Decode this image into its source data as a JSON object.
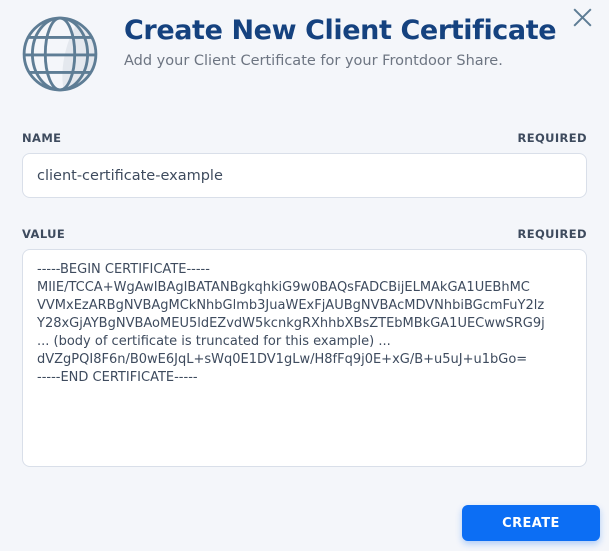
{
  "dialog": {
    "title": "Create New Client Certificate",
    "subtitle": "Add your Client Certificate for your Frontdoor Share."
  },
  "fields": {
    "name": {
      "label": "NAME",
      "required": "REQUIRED",
      "value": "client-certificate-example"
    },
    "value": {
      "label": "VALUE",
      "required": "REQUIRED",
      "value": "-----BEGIN CERTIFICATE-----\nMIIE/TCCA+WgAwIBAgIBATANBgkqhkiG9w0BAQsFADCBijELMAkGA1UEBhMC\nVVMxEzARBgNVBAgMCkNhbGlmb3JuaWExFjAUBgNVBAcMDVNhbiBGcmFuY2lz\nY28xGjAYBgNVBAoMEU5ldEZvdW5kcnkgRXhhbXBsZTEbMBkGA1UECwwSRG9j\n... (body of certificate is truncated for this example) ...\ndVZgPQI8F6n/B0wE6JqL+sWq0E1DV1gLw/H8fFq9j0E+xG/B+u5uJ+u1bGo=\n-----END CERTIFICATE-----"
    }
  },
  "footer": {
    "create_label": "CREATE"
  },
  "icons": {
    "header_icon": "globe-icon",
    "close_icon": "close-icon"
  },
  "colors": {
    "title_text": "#15427f",
    "button_blue": "#0c6ef4",
    "icon_stroke": "#5e7d95",
    "label_text": "#3e4b5e",
    "page_background": "#f4f6fa",
    "field_border": "#d9dfe9"
  }
}
